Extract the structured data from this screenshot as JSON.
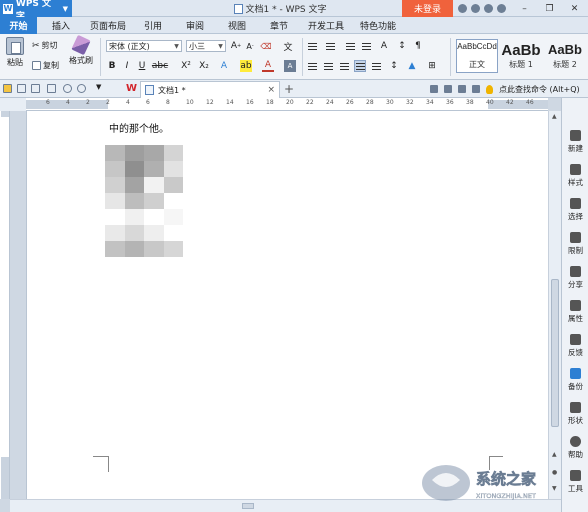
{
  "app": {
    "menu_label": "WPS 文字",
    "window_title": "文档1 * - WPS 文字",
    "login_label": "未登录"
  },
  "menu_tabs": [
    {
      "label": "开始",
      "active": true
    },
    {
      "label": "插入"
    },
    {
      "label": "页面布局"
    },
    {
      "label": "引用"
    },
    {
      "label": "审阅"
    },
    {
      "label": "视图"
    },
    {
      "label": "章节"
    },
    {
      "label": "开发工具"
    },
    {
      "label": "特色功能"
    }
  ],
  "ribbon": {
    "paste_label": "粘贴",
    "cut_label": "剪切",
    "copy_label": "复制",
    "format_painter_label": "格式刷",
    "font_name": "宋体 (正文)",
    "font_size": "小三",
    "styles": [
      {
        "sample": "AaBbCcDd",
        "name": "正文"
      },
      {
        "sample": "AaBb",
        "name": "标题 1"
      },
      {
        "sample": "AaBb",
        "name": "标题 2"
      }
    ]
  },
  "tabbar": {
    "doc_tab_label": "文档1 *",
    "close_glyph": "×",
    "new_tab_glyph": "+",
    "search_hint": "点此查找命令 (Alt+Q)"
  },
  "ruler": {
    "numbers": [
      "6",
      "4",
      "2",
      "2",
      "4",
      "6",
      "8",
      "10",
      "12",
      "14",
      "16",
      "18",
      "20",
      "22",
      "24",
      "26",
      "28",
      "30",
      "32",
      "34",
      "36",
      "38",
      "40",
      "42",
      "46"
    ]
  },
  "document": {
    "body_text": "中的那个他。"
  },
  "sidepanel": {
    "items": [
      {
        "label": "新建",
        "icon": "new-doc-icon"
      },
      {
        "label": "样式",
        "icon": "style-icon"
      },
      {
        "label": "选择",
        "icon": "select-icon"
      },
      {
        "label": "限制",
        "icon": "restrict-icon"
      },
      {
        "label": "分享",
        "icon": "share-icon"
      },
      {
        "label": "属性",
        "icon": "properties-icon"
      },
      {
        "label": "反馈",
        "icon": "feedback-icon"
      },
      {
        "label": "备份",
        "icon": "backup-icon"
      },
      {
        "label": "形状",
        "icon": "shape-icon"
      },
      {
        "label": "帮助",
        "icon": "help-icon"
      },
      {
        "label": "工具",
        "icon": "tools-icon"
      }
    ]
  },
  "watermark": {
    "brand": "系统之家",
    "url": "XITONGZHIJIA.NET"
  },
  "colors": {
    "accent": "#2d7fd3",
    "login": "#f0623c",
    "wps_red": "#d2252b"
  }
}
